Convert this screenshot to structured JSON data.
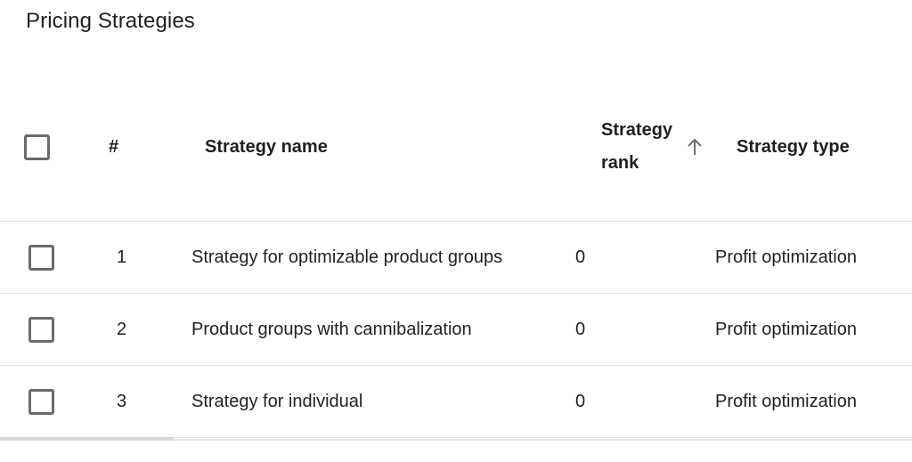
{
  "page": {
    "title": "Pricing Strategies"
  },
  "table": {
    "columns": {
      "select_all": "",
      "number": "#",
      "name": "Strategy name",
      "rank_line1": "Strategy",
      "rank_line2": "rank",
      "type": "Strategy type"
    },
    "sort": {
      "column": "Strategy rank",
      "direction": "ascending",
      "icon": "arrow-up-icon"
    },
    "rows": [
      {
        "number": "1",
        "name": "Strategy for optimizable product groups",
        "rank": "0",
        "type": "Profit optimization",
        "selected": false
      },
      {
        "number": "2",
        "name": "Product groups with cannibalization",
        "rank": "0",
        "type": "Profit optimization",
        "selected": false
      },
      {
        "number": "3",
        "name": "Strategy for individual",
        "rank": "0",
        "type": "Profit optimization",
        "selected": false
      }
    ]
  },
  "scrollbar": {
    "orientation": "horizontal",
    "position_fraction": 0.0,
    "visible_fraction": 0.19
  }
}
